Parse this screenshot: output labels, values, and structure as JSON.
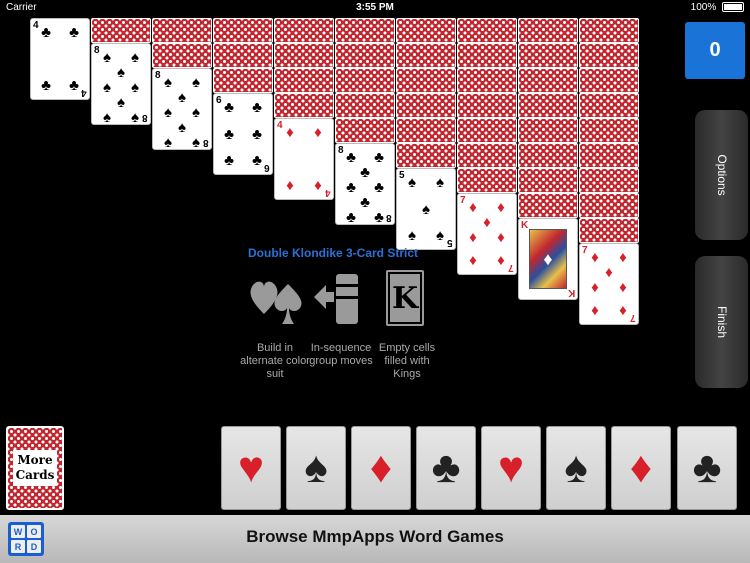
{
  "status_bar": {
    "carrier": "Carrier",
    "time": "3:55 PM",
    "battery": "100%"
  },
  "score": "0",
  "side_buttons": {
    "options": "Options",
    "finish": "Finish"
  },
  "rules": {
    "title": "Double Klondike 3-Card Strict",
    "items": [
      {
        "icon": "heart-spade-icon",
        "text": "Build in alternate color suit"
      },
      {
        "icon": "group-move-icon",
        "text": "In-sequence group moves"
      },
      {
        "icon": "king-icon",
        "glyph": "K",
        "text": "Empty cells filled with Kings"
      }
    ]
  },
  "tableau": [
    {
      "hidden": 0,
      "card": {
        "rank": "4",
        "suit": "♣",
        "color": "black"
      }
    },
    {
      "hidden": 1,
      "card": {
        "rank": "8",
        "suit": "♠",
        "color": "black"
      }
    },
    {
      "hidden": 2,
      "card": {
        "rank": "8",
        "suit": "♠",
        "color": "black"
      }
    },
    {
      "hidden": 3,
      "card": {
        "rank": "6",
        "suit": "♣",
        "color": "black"
      }
    },
    {
      "hidden": 4,
      "card": {
        "rank": "4",
        "suit": "♦",
        "color": "red"
      }
    },
    {
      "hidden": 5,
      "card": {
        "rank": "8",
        "suit": "♣",
        "color": "black"
      }
    },
    {
      "hidden": 6,
      "card": {
        "rank": "5",
        "suit": "♠",
        "color": "black"
      }
    },
    {
      "hidden": 7,
      "card": {
        "rank": "7",
        "suit": "♦",
        "color": "red"
      }
    },
    {
      "hidden": 8,
      "card": {
        "rank": "K",
        "suit": "♦",
        "color": "red"
      }
    },
    {
      "hidden": 9,
      "card": {
        "rank": "7",
        "suit": "♦",
        "color": "red"
      }
    }
  ],
  "stock": {
    "label_line1": "More",
    "label_line2": "Cards"
  },
  "foundations": [
    {
      "suit": "♥",
      "color": "#d8202a",
      "icon": "heart-icon"
    },
    {
      "suit": "♠",
      "color": "#222222",
      "icon": "spade-icon"
    },
    {
      "suit": "♦",
      "color": "#d8202a",
      "icon": "diamond-icon"
    },
    {
      "suit": "♣",
      "color": "#222222",
      "icon": "club-icon"
    },
    {
      "suit": "♥",
      "color": "#d8202a",
      "icon": "heart-icon"
    },
    {
      "suit": "♠",
      "color": "#222222",
      "icon": "spade-icon"
    },
    {
      "suit": "♦",
      "color": "#d8202a",
      "icon": "diamond-icon"
    },
    {
      "suit": "♣",
      "color": "#222222",
      "icon": "club-icon"
    }
  ],
  "banner": {
    "title": "Browse MmpApps Word Games",
    "logo_letters": [
      "W",
      "O",
      "R",
      "D"
    ]
  }
}
